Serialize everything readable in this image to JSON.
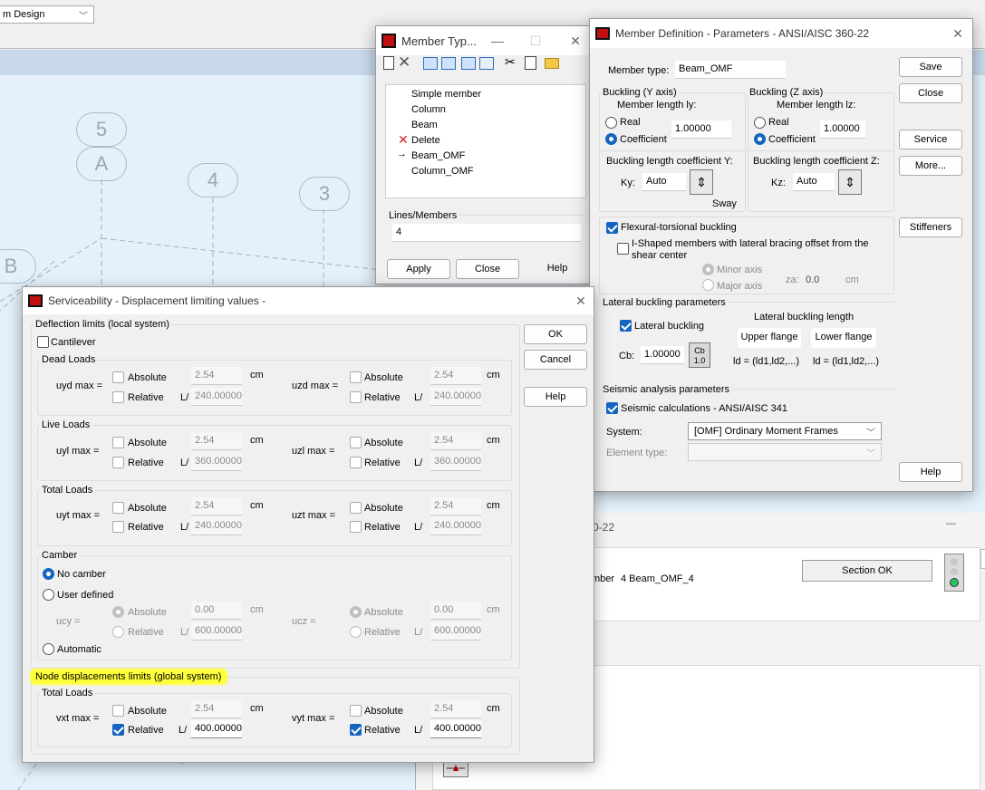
{
  "top_combo": {
    "value": "m Design"
  },
  "canvas": {
    "labels": [
      "5",
      "A",
      "4",
      "3",
      "B"
    ]
  },
  "member_types": {
    "title": "Member Typ...",
    "list": [
      "Simple member",
      "Column",
      "Beam",
      "Delete",
      "Beam_OMF",
      "Column_OMF"
    ],
    "lines_label": "Lines/Members",
    "lines_value": "4",
    "apply": "Apply",
    "close": "Close",
    "help": "Help"
  },
  "member_def": {
    "title": "Member Definition - Parameters - ANSI/AISC 360-22",
    "member_type_label": "Member type:",
    "member_type_value": "Beam_OMF",
    "save": "Save",
    "close": "Close",
    "service": "Service",
    "more": "More...",
    "stiffeners": "Stiffeners",
    "help": "Help",
    "buckling_y": {
      "title": "Buckling (Y axis)",
      "length_label": "Member length ly:",
      "real": "Real",
      "coefficient": "Coefficient",
      "value": "1.00000",
      "coef_title": "Buckling length coefficient Y:",
      "k_label": "Ky:",
      "k_value": "Auto",
      "sway": "Sway"
    },
    "buckling_z": {
      "title": "Buckling (Z axis)",
      "length_label": "Member length lz:",
      "real": "Real",
      "coefficient": "Coefficient",
      "value": "1.00000",
      "coef_title": "Buckling length coefficient Z:",
      "k_label": "Kz:",
      "k_value": "Auto"
    },
    "ftb": "Flexural-torsional buckling",
    "ishaped": "I-Shaped members with lateral bracing offset from the shear center",
    "minor_axis": "Minor axis",
    "major_axis": "Major axis",
    "za_label": "za:",
    "za_value": "0.0",
    "za_unit": "cm",
    "lateral_title": "Lateral buckling parameters",
    "lateral_buckling": "Lateral buckling",
    "lbl_title": "Lateral buckling length",
    "upper_flange": "Upper flange",
    "lower_flange": "Lower flange",
    "cb_label": "Cb:",
    "cb_value": "1.00000",
    "cb_btn_top": "Cb",
    "cb_btn_bot": "1.0",
    "ld_upper": "ld = (ld1,ld2,...)",
    "ld_lower": "ld = (ld1,ld2,...)",
    "seismic_title": "Seismic analysis parameters",
    "seismic_calc": "Seismic calculations - ANSI/AISC 341",
    "system_label": "System:",
    "system_value": "[OMF] Ordinary Moment Frames",
    "element_type_label": "Element type:"
  },
  "bg_window": {
    "title_frag": "0-22",
    "member_label": "mber",
    "member_value": "4  Beam_OMF_4",
    "status": "Section OK"
  },
  "service": {
    "title": "Serviceability - Displacement limiting values -",
    "ok": "OK",
    "cancel": "Cancel",
    "help": "Help",
    "deflection_title": "Deflection limits (local system)",
    "cantilever": "Cantilever",
    "absolute": "Absolute",
    "relative": "Relative",
    "cm": "cm",
    "L": "L/",
    "dead": {
      "title": "Dead Loads",
      "left_label": "uyd max =",
      "right_label": "uzd max =",
      "abs_left": "2.54",
      "abs_right": "2.54",
      "rel_left": "240.00000",
      "rel_right": "240.00000"
    },
    "live": {
      "title": "Live Loads",
      "left_label": "uyl max =",
      "right_label": "uzl max =",
      "abs_left": "2.54",
      "abs_right": "2.54",
      "rel_left": "360.00000",
      "rel_right": "360.00000"
    },
    "total": {
      "title": "Total Loads",
      "left_label": "uyt max =",
      "right_label": "uzt max =",
      "abs_left": "2.54",
      "abs_right": "2.54",
      "rel_left": "240.00000",
      "rel_right": "240.00000"
    },
    "camber": {
      "title": "Camber",
      "no_camber": "No camber",
      "user_defined": "User defined",
      "automatic": "Automatic",
      "left_label": "ucy =",
      "right_label": "ucz =",
      "abs_left": "0.00",
      "abs_right": "0.00",
      "rel_left": "600.00000",
      "rel_right": "600.00000"
    },
    "node_title": "Node displacements limits (global system)",
    "node": {
      "title": "Total Loads",
      "left_label": "vxt max =",
      "right_label": "vyt max =",
      "abs_left": "2.54",
      "abs_right": "2.54",
      "rel_left": "400.00000",
      "rel_right": "400.00000"
    },
    "highlight_color": "#ffff3a"
  }
}
